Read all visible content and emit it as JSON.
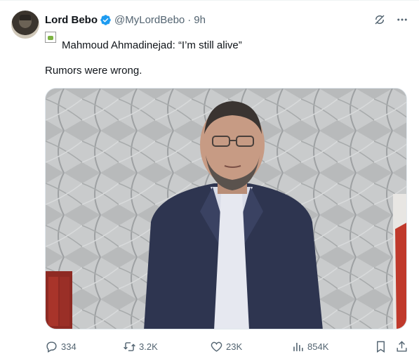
{
  "author": {
    "name": "Lord Bebo",
    "handle": "@MyLordBebo",
    "separator": "·",
    "time": "9h"
  },
  "quote_text": "Mahmoud Ahmadinejad: “I’m still alive”",
  "body_text": "Rumors were wrong.",
  "stats": {
    "replies": "334",
    "reposts": "3.2K",
    "likes": "23K",
    "views": "854K"
  },
  "colors": {
    "verified": "#1d9bf0",
    "secondary_text": "#536471",
    "primary_text": "#0f1419"
  },
  "icons": [
    "verified-badge-icon",
    "grok-icon",
    "more-icon",
    "broken-image-icon",
    "reply-icon",
    "retweet-icon",
    "like-icon",
    "views-icon",
    "bookmark-icon",
    "share-icon"
  ]
}
